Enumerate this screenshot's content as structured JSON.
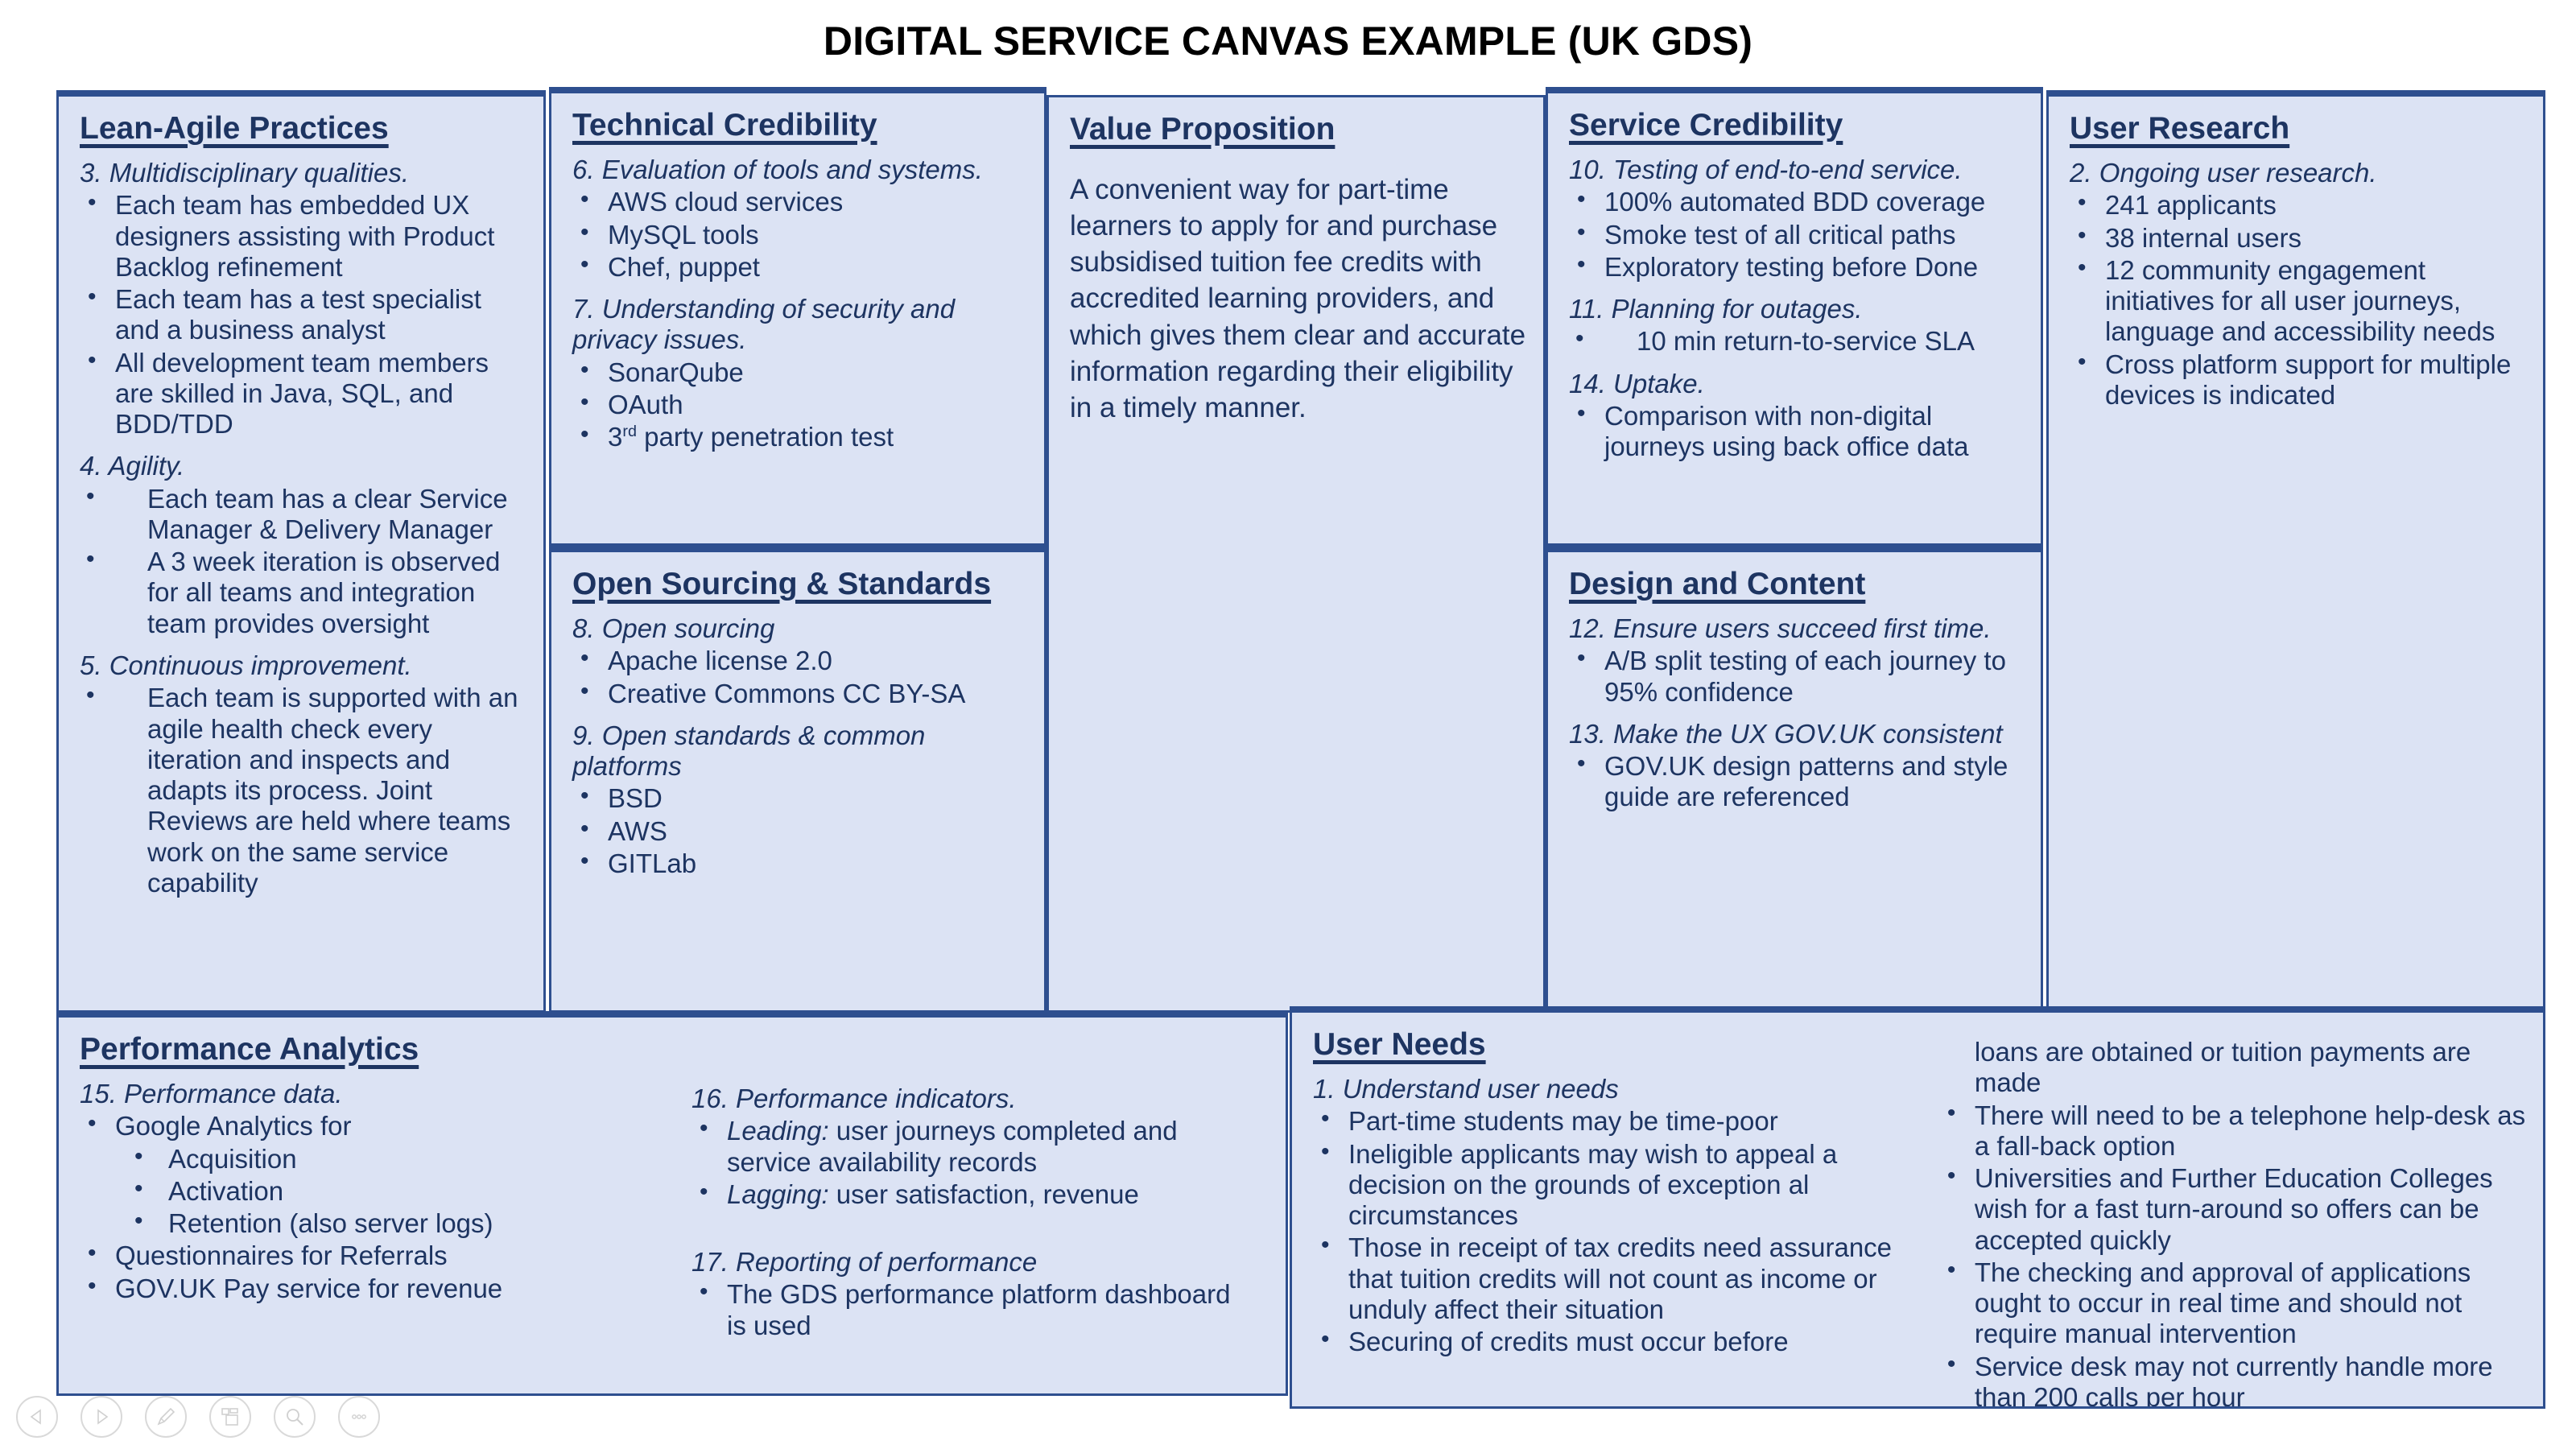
{
  "slide": {
    "title": "DIGITAL SERVICE CANVAS EXAMPLE (UK GDS)",
    "accent_border": "#2e4f8f",
    "panel_fill": "#dce3f4",
    "text_color": "#1d3461"
  },
  "panels": {
    "lean_agile": {
      "title": "Lean-Agile Practices",
      "groups": [
        {
          "heading": "3. Multidisciplinary qualities.",
          "bullets": [
            "Each team has embedded UX designers assisting with Product Backlog refinement",
            "Each team has a test specialist and a business analyst",
            "All development team members are skilled in Java, SQL, and BDD/TDD"
          ]
        },
        {
          "heading": "4. Agility.",
          "bullets": [
            "Each team has a clear Service Manager & Delivery Manager",
            "A 3 week iteration is observed for all teams and integration team provides oversight"
          ]
        },
        {
          "heading": "5. Continuous improvement.",
          "bullets": [
            "Each team is supported with an agile health check every iteration and inspects and adapts its process. Joint Reviews are held where teams work on the same service capability"
          ]
        }
      ]
    },
    "technical_credibility": {
      "title": "Technical Credibility",
      "groups": [
        {
          "heading": "6. Evaluation of tools and systems.",
          "bullets": [
            "AWS cloud services",
            "MySQL tools",
            "Chef, puppet"
          ]
        },
        {
          "heading": "7. Understanding of security and privacy issues.",
          "bullets": [
            "SonarQube",
            "OAuth",
            "3rd party penetration test"
          ]
        }
      ]
    },
    "open_sourcing": {
      "title": "Open Sourcing & Standards",
      "groups": [
        {
          "heading": "8. Open sourcing",
          "bullets": [
            "Apache license 2.0",
            "Creative Commons CC BY-SA"
          ]
        },
        {
          "heading": "9. Open standards & common platforms",
          "bullets": [
            "BSD",
            "AWS",
            "GITLab"
          ]
        }
      ]
    },
    "value_proposition": {
      "title": "Value Proposition",
      "paragraph": "A convenient way for part-time learners to apply for and purchase subsidised tuition fee credits with accredited learning providers, and which gives them clear and accurate information regarding their eligibility in a timely manner."
    },
    "service_credibility": {
      "title": "Service Credibility",
      "groups": [
        {
          "heading": "10. Testing of end-to-end service.",
          "bullets": [
            "100% automated BDD coverage",
            "Smoke test of all critical paths",
            "Exploratory testing before Done"
          ]
        },
        {
          "heading": "11. Planning for outages.",
          "bullets": [
            "10 min return-to-service SLA"
          ]
        },
        {
          "heading": "14. Uptake.",
          "bullets": [
            "Comparison with non-digital journeys using back office data"
          ]
        }
      ]
    },
    "design_content": {
      "title": "Design and Content",
      "groups": [
        {
          "heading": "12. Ensure users succeed first time.",
          "bullets": [
            "A/B split testing of each journey to 95% confidence"
          ]
        },
        {
          "heading": "13. Make the UX GOV.UK consistent",
          "bullets": [
            "GOV.UK design patterns and style guide are referenced"
          ]
        }
      ]
    },
    "user_research": {
      "title": "User Research",
      "groups": [
        {
          "heading": "2. Ongoing user research.",
          "bullets": [
            "241 applicants",
            "38 internal users",
            "12 community engagement initiatives for all user journeys, language and accessibility needs",
            "Cross platform support for multiple devices is indicated"
          ]
        }
      ]
    },
    "performance_analytics": {
      "title": "Performance Analytics",
      "group_15": {
        "heading": "15. Performance data.",
        "bullet_1": "Google Analytics for",
        "sub_bullets": [
          "Acquisition",
          "Activation",
          "Retention (also server logs)"
        ],
        "bullets_after": [
          "Questionnaires for Referrals",
          "GOV.UK Pay service for revenue"
        ]
      },
      "group_16": {
        "heading": "16. Performance indicators.",
        "bullets": [
          {
            "lead": "Leading:",
            "text": " user journeys completed and service availability records"
          },
          {
            "lead": "Lagging:",
            "text": " user satisfaction, revenue"
          }
        ]
      },
      "group_17": {
        "heading": "17. Reporting of performance",
        "bullets": [
          "The GDS performance platform dashboard is used"
        ]
      }
    },
    "user_needs": {
      "title": "User Needs",
      "heading": "1. Understand user needs",
      "bullets_left": [
        "Part-time students may be time-poor",
        "Ineligible applicants may wish to appeal a decision on the grounds of exception al circumstances",
        "Those in receipt of tax credits need assurance that tuition credits will not count as income or unduly affect their situation",
        "Securing of credits must occur before"
      ],
      "continuation": "loans are obtained or tuition payments are made",
      "bullets_right": [
        "There will need to be a telephone help-desk as a fall-back option",
        "Universities and Further Education Colleges wish for a fast turn-around so offers can be accepted quickly",
        "The checking and approval of applications ought to occur in real time and should not require manual intervention",
        "Service desk may not currently handle more than 200 calls per hour"
      ]
    }
  },
  "toolbar": {
    "previous_label": "Previous slide",
    "next_label": "Next slide",
    "pen_label": "Pen and laser pointer tools",
    "grid_label": "See all slides",
    "zoom_label": "Zoom into the slide",
    "more_label": "More slide show options"
  }
}
